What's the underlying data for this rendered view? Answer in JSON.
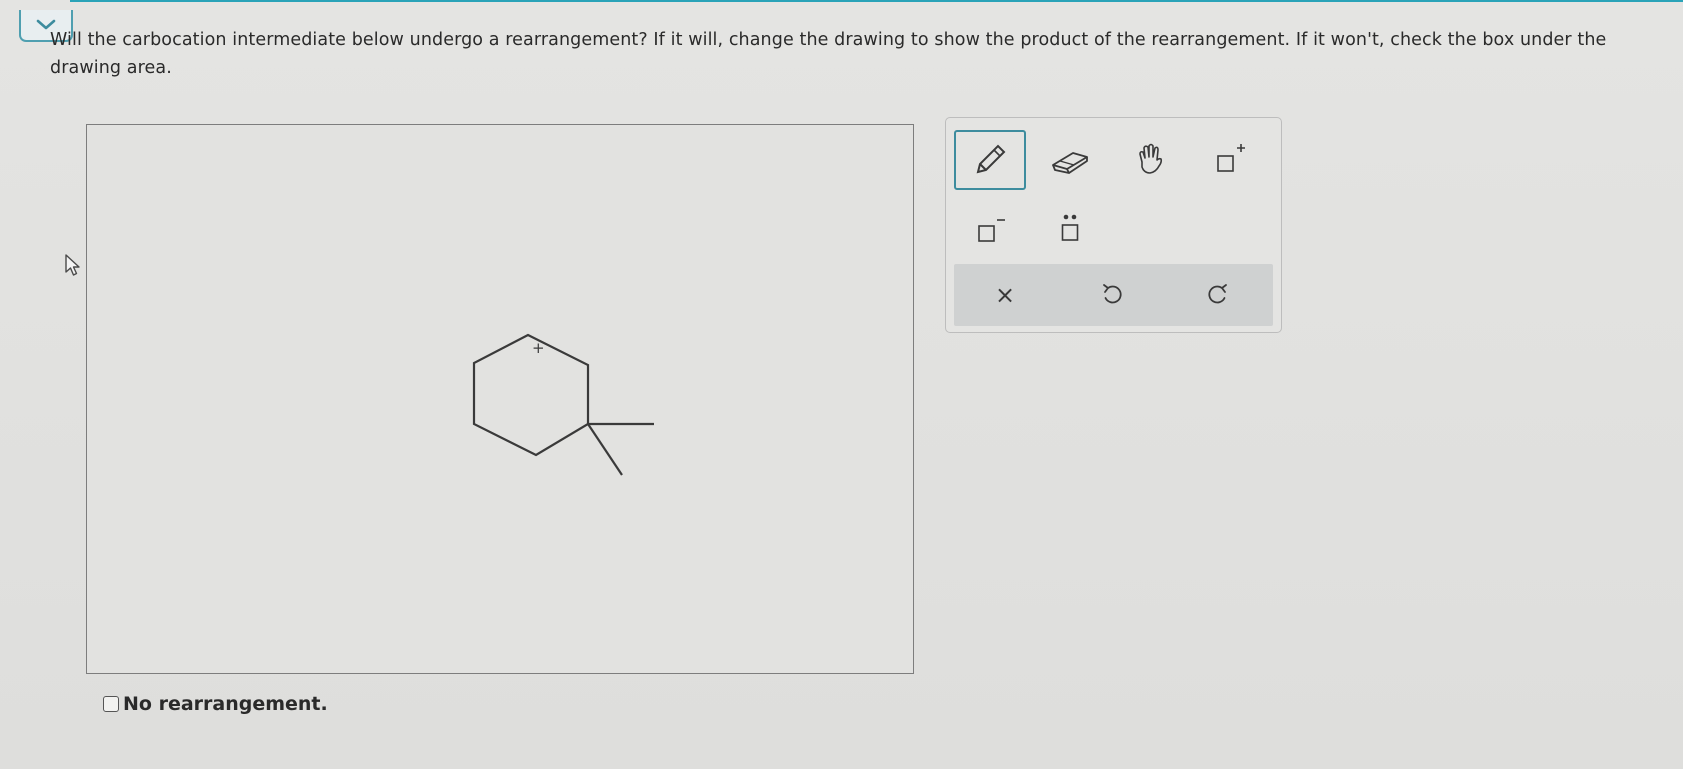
{
  "question": {
    "text": "Will the carbocation intermediate below undergo a rearrangement? If it will, change the drawing to show the product of the rearrangement. If it won't, check the box under the drawing area."
  },
  "drawing": {
    "charge_label": "+"
  },
  "palette": {
    "tools": [
      {
        "name": "pencil-icon",
        "active": true
      },
      {
        "name": "eraser-icon",
        "active": false
      },
      {
        "name": "hand-icon",
        "active": false
      },
      {
        "name": "positive-charge-icon",
        "active": false
      },
      {
        "name": "negative-charge-icon",
        "active": false
      },
      {
        "name": "lone-pair-icon",
        "active": false
      }
    ],
    "actions": [
      {
        "name": "clear-icon",
        "glyph": "×"
      },
      {
        "name": "undo-icon"
      },
      {
        "name": "redo-icon"
      }
    ]
  },
  "options": {
    "no_rearrangement_label": "No rearrangement.",
    "checked": false
  },
  "colors": {
    "accent": "#3d8c9e",
    "top_strip": "#2aa3b8",
    "bond": "#3a3a3a"
  }
}
